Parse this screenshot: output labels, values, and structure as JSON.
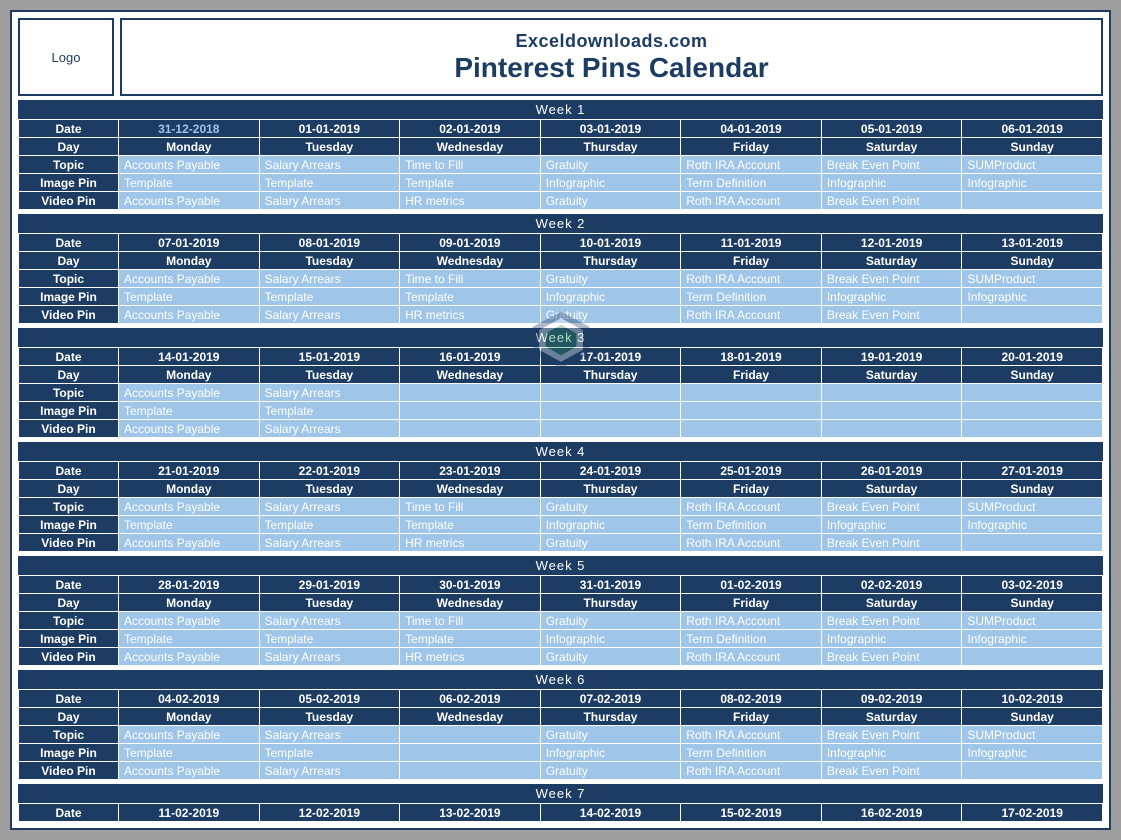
{
  "header": {
    "logo_label": "Logo",
    "site": "Exceldownloads.com",
    "title": "Pinterest Pins Calendar"
  },
  "row_labels": {
    "date": "Date",
    "day": "Day",
    "topic": "Topic",
    "image_pin": "Image Pin",
    "video_pin": "Video Pin"
  },
  "days": [
    "Monday",
    "Tuesday",
    "Wednesday",
    "Thursday",
    "Friday",
    "Saturday",
    "Sunday"
  ],
  "weeks": [
    {
      "title": "Week   1",
      "dates": [
        "31-12-2018",
        "01-01-2019",
        "02-01-2019",
        "03-01-2019",
        "04-01-2019",
        "05-01-2019",
        "06-01-2019"
      ],
      "selected_date_index": 0,
      "topic": [
        "Accounts Payable",
        "Salary Arrears",
        "Time to Fill",
        "Gratuity",
        "Roth IRA Account",
        "Break Even Point",
        "SUMProduct"
      ],
      "image_pin": [
        "Template",
        "Template",
        "Template",
        "Infographic",
        "Term Definition",
        "Infographic",
        "Infographic"
      ],
      "video_pin": [
        "Accounts Payable",
        "Salary Arrears",
        "HR metrics",
        "Gratuity",
        "Roth IRA Account",
        "Break Even Point",
        ""
      ]
    },
    {
      "title": "Week   2",
      "dates": [
        "07-01-2019",
        "08-01-2019",
        "09-01-2019",
        "10-01-2019",
        "11-01-2019",
        "12-01-2019",
        "13-01-2019"
      ],
      "topic": [
        "Accounts Payable",
        "Salary Arrears",
        "Time to Fill",
        "Gratuity",
        "Roth IRA Account",
        "Break Even Point",
        "SUMProduct"
      ],
      "image_pin": [
        "Template",
        "Template",
        "Template",
        "Infographic",
        "Term Definition",
        "Infographic",
        "Infographic"
      ],
      "video_pin": [
        "Accounts Payable",
        "Salary Arrears",
        "HR metrics",
        "Gratuity",
        "Roth IRA Account",
        "Break Even Point",
        ""
      ]
    },
    {
      "title": "Week   3",
      "dates": [
        "14-01-2019",
        "15-01-2019",
        "16-01-2019",
        "17-01-2019",
        "18-01-2019",
        "19-01-2019",
        "20-01-2019"
      ],
      "topic": [
        "Accounts Payable",
        "Salary Arrears",
        "",
        "",
        "",
        "",
        ""
      ],
      "image_pin": [
        "Template",
        "Template",
        "",
        "",
        "",
        "",
        ""
      ],
      "video_pin": [
        "Accounts Payable",
        "Salary Arrears",
        "",
        "",
        "",
        "",
        ""
      ]
    },
    {
      "title": "Week   4",
      "dates": [
        "21-01-2019",
        "22-01-2019",
        "23-01-2019",
        "24-01-2019",
        "25-01-2019",
        "26-01-2019",
        "27-01-2019"
      ],
      "topic": [
        "Accounts Payable",
        "Salary Arrears",
        "Time to Fill",
        "Gratuity",
        "Roth IRA Account",
        "Break Even Point",
        "SUMProduct"
      ],
      "image_pin": [
        "Template",
        "Template",
        "Template",
        "Infographic",
        "Term Definition",
        "Infographic",
        "Infographic"
      ],
      "video_pin": [
        "Accounts Payable",
        "Salary Arrears",
        "HR metrics",
        "Gratuity",
        "Roth IRA Account",
        "Break Even Point",
        ""
      ]
    },
    {
      "title": "Week   5",
      "dates": [
        "28-01-2019",
        "29-01-2019",
        "30-01-2019",
        "31-01-2019",
        "01-02-2019",
        "02-02-2019",
        "03-02-2019"
      ],
      "topic": [
        "Accounts Payable",
        "Salary Arrears",
        "Time to Fill",
        "Gratuity",
        "Roth IRA Account",
        "Break Even Point",
        "SUMProduct"
      ],
      "image_pin": [
        "Template",
        "Template",
        "Template",
        "Infographic",
        "Term Definition",
        "Infographic",
        "Infographic"
      ],
      "video_pin": [
        "Accounts Payable",
        "Salary Arrears",
        "HR metrics",
        "Gratuity",
        "Roth IRA Account",
        "Break Even Point",
        ""
      ]
    },
    {
      "title": "Week   6",
      "dates": [
        "04-02-2019",
        "05-02-2019",
        "06-02-2019",
        "07-02-2019",
        "08-02-2019",
        "09-02-2019",
        "10-02-2019"
      ],
      "topic": [
        "Accounts Payable",
        "Salary Arrears",
        "",
        "Gratuity",
        "Roth IRA Account",
        "Break Even Point",
        "SUMProduct"
      ],
      "image_pin": [
        "Template",
        "Template",
        "",
        "Infographic",
        "Term Definition",
        "Infographic",
        "Infographic"
      ],
      "video_pin": [
        "Accounts Payable",
        "Salary Arrears",
        "",
        "Gratuity",
        "Roth IRA Account",
        "Break Even Point",
        ""
      ]
    },
    {
      "title": "Week   7",
      "dates": [
        "11-02-2019",
        "12-02-2019",
        "13-02-2019",
        "14-02-2019",
        "15-02-2019",
        "16-02-2019",
        "17-02-2019"
      ],
      "dates_only": true
    }
  ]
}
